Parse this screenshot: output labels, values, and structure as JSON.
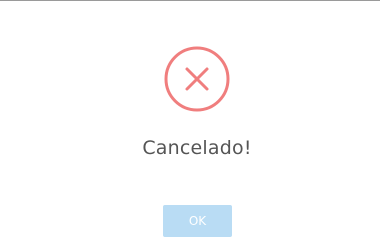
{
  "dialog": {
    "icon": "error-x-icon",
    "title": "Cancelado!",
    "ok_label": "OK"
  },
  "colors": {
    "icon_red": "#f07e7e",
    "title_text": "#555555",
    "ok_button_bg": "#b9dcf4",
    "ok_button_text": "#ffffff",
    "top_border": "#9a9a9a"
  }
}
